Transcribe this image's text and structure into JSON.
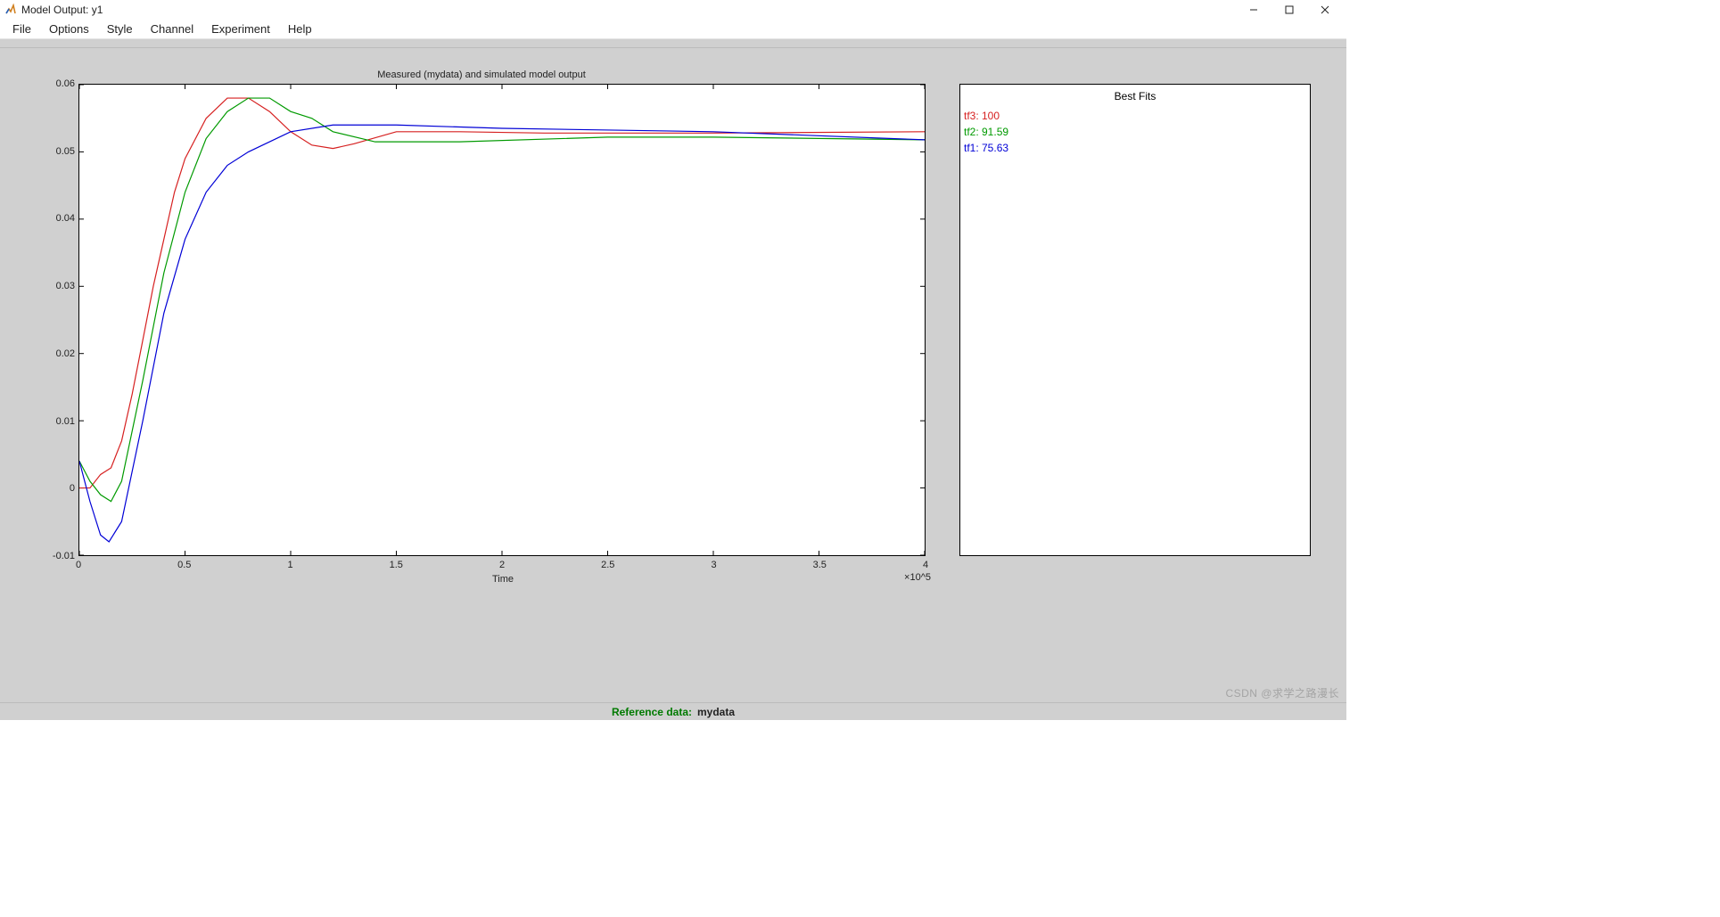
{
  "window": {
    "title": "Model Output: y1"
  },
  "menu": [
    "File",
    "Options",
    "Style",
    "Channel",
    "Experiment",
    "Help"
  ],
  "status": {
    "label": "Reference data:",
    "value": "mydata"
  },
  "watermark": "CSDN @求学之路漫长",
  "legend": {
    "title": "Best Fits",
    "items": [
      {
        "label": "tf3: 100",
        "class": "fit-red"
      },
      {
        "label": "tf2: 91.59",
        "class": "fit-green"
      },
      {
        "label": "tf1: 75.63",
        "class": "fit-blue"
      }
    ]
  },
  "chart_data": {
    "type": "line",
    "title": "Measured (mydata) and simulated model output",
    "xlabel": "Time",
    "ylabel": "",
    "x_exponent": "×10^5",
    "x_ticks": [
      0,
      0.5,
      1,
      1.5,
      2,
      2.5,
      3,
      3.5,
      4
    ],
    "y_ticks": [
      -0.01,
      0,
      0.01,
      0.02,
      0.03,
      0.04,
      0.05,
      0.06
    ],
    "xlim": [
      0,
      4
    ],
    "ylim": [
      -0.01,
      0.06
    ],
    "series": [
      {
        "name": "tf3",
        "color": "red",
        "x": [
          0,
          0.05,
          0.1,
          0.15,
          0.2,
          0.25,
          0.3,
          0.35,
          0.4,
          0.45,
          0.5,
          0.6,
          0.7,
          0.8,
          0.9,
          1.0,
          1.1,
          1.2,
          1.3,
          1.5,
          1.8,
          2.2,
          3.0,
          4.0
        ],
        "y": [
          0.0,
          0.0,
          0.002,
          0.003,
          0.007,
          0.014,
          0.022,
          0.03,
          0.037,
          0.044,
          0.049,
          0.055,
          0.058,
          0.058,
          0.056,
          0.053,
          0.051,
          0.0505,
          0.0512,
          0.053,
          0.053,
          0.0528,
          0.0528,
          0.053
        ]
      },
      {
        "name": "tf2",
        "color": "green",
        "x": [
          0,
          0.05,
          0.1,
          0.15,
          0.2,
          0.3,
          0.4,
          0.5,
          0.6,
          0.7,
          0.8,
          0.9,
          1.0,
          1.1,
          1.2,
          1.4,
          1.8,
          2.5,
          3.0,
          4.0
        ],
        "y": [
          0.004,
          0.001,
          -0.001,
          -0.002,
          0.001,
          0.016,
          0.032,
          0.044,
          0.052,
          0.056,
          0.058,
          0.058,
          0.056,
          0.055,
          0.053,
          0.0515,
          0.0515,
          0.0522,
          0.0522,
          0.0518
        ]
      },
      {
        "name": "tf1",
        "color": "blue",
        "x": [
          0,
          0.05,
          0.1,
          0.14,
          0.2,
          0.3,
          0.4,
          0.5,
          0.6,
          0.7,
          0.8,
          1.0,
          1.2,
          1.5,
          2.0,
          3.0,
          4.0
        ],
        "y": [
          0.004,
          -0.002,
          -0.007,
          -0.008,
          -0.005,
          0.01,
          0.026,
          0.037,
          0.044,
          0.048,
          0.05,
          0.053,
          0.054,
          0.054,
          0.0535,
          0.053,
          0.0518
        ]
      }
    ]
  }
}
